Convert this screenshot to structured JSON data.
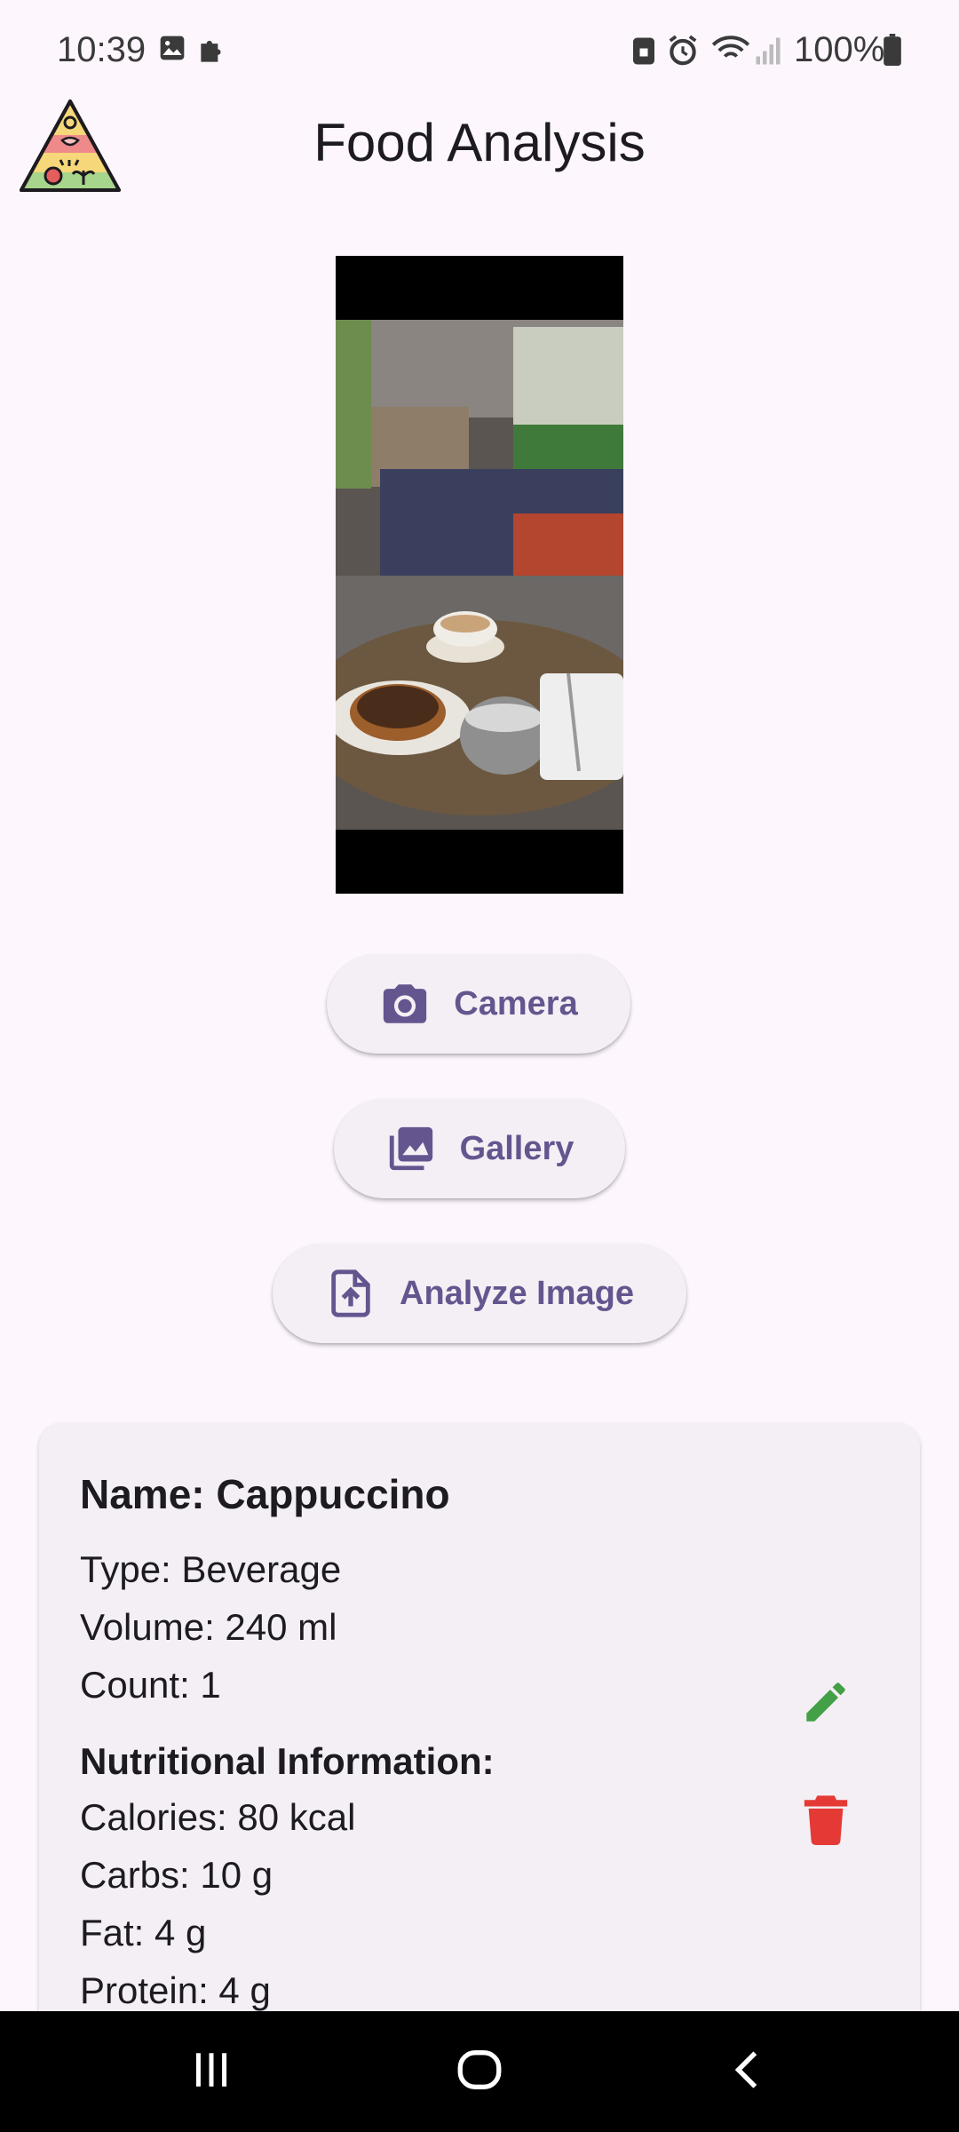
{
  "status_bar": {
    "time": "10:39",
    "battery": "100%",
    "icons": [
      "gallery-icon",
      "puzzle-icon",
      "lock-battery-icon",
      "alarm-icon",
      "wifi-icon",
      "signal-icon",
      "battery-icon"
    ]
  },
  "app_bar": {
    "title": "Food Analysis",
    "logo": "food-pyramid-logo"
  },
  "image_preview": {
    "description_icon": "food-photo"
  },
  "buttons": {
    "camera": "Camera",
    "gallery": "Gallery",
    "analyze": "Analyze Image"
  },
  "result": {
    "name": "Name: Cappuccino",
    "type": "Type: Beverage",
    "volume": "Volume: 240 ml",
    "count": "Count: 1",
    "nutrition_title": "Nutritional Information:",
    "calories": "Calories: 80 kcal",
    "carbs": "Carbs: 10 g",
    "fat": "Fat: 4 g",
    "protein": "Protein: 4 g"
  },
  "colors": {
    "accent": "#65558f",
    "edit": "#43a047",
    "delete": "#e53935",
    "background": "#fdf7fd"
  }
}
